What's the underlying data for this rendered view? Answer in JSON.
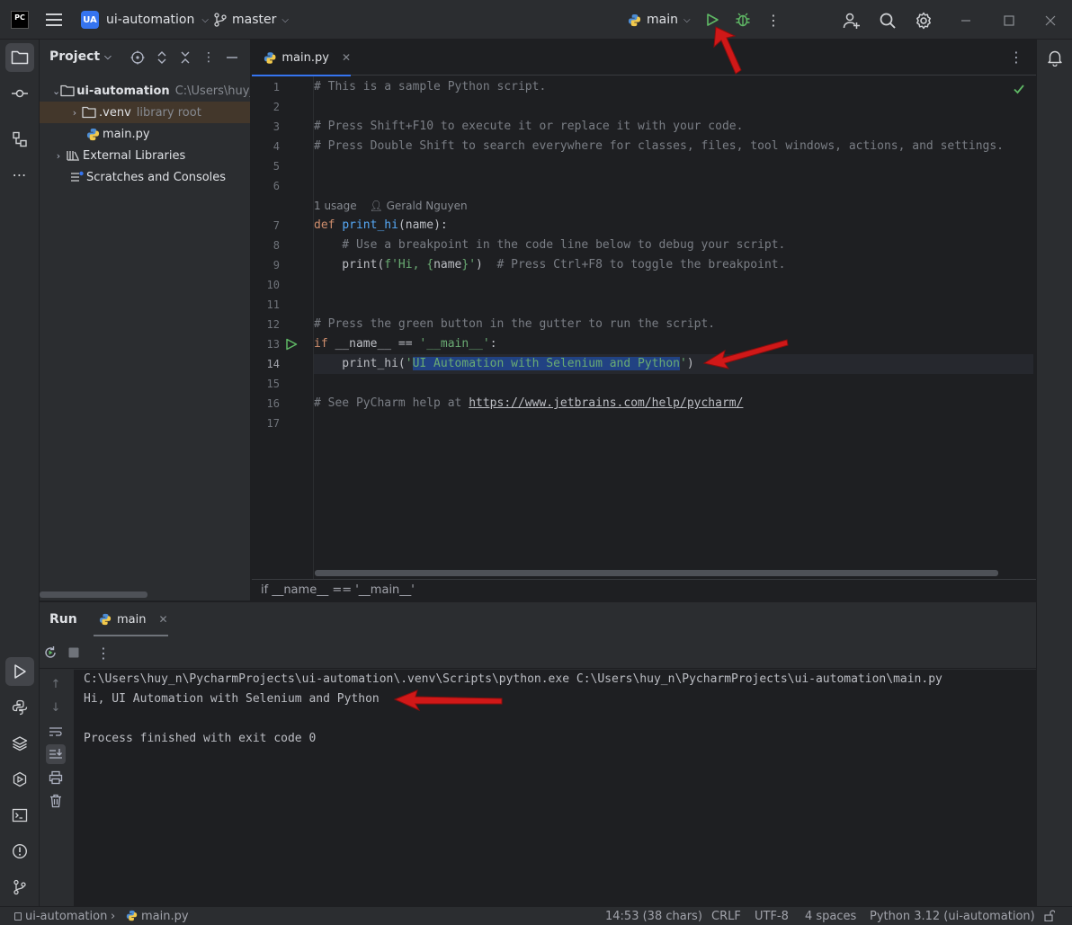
{
  "titlebar": {
    "logo": "PC",
    "project_badge": "UA",
    "project_name": "ui-automation",
    "branch": "master",
    "run_config": "main"
  },
  "project_pane": {
    "title": "Project",
    "tree": [
      {
        "label": "ui-automation",
        "hint": "C:\\Users\\huy_n"
      },
      {
        "label": ".venv",
        "hint": "library root"
      },
      {
        "label": "main.py",
        "hint": ""
      },
      {
        "label": "External Libraries",
        "hint": ""
      },
      {
        "label": "Scratches and Consoles",
        "hint": ""
      }
    ]
  },
  "editor": {
    "tab": "main.py",
    "line_numbers": [
      "1",
      "2",
      "3",
      "4",
      "5",
      "6",
      "7",
      "8",
      "9",
      "10",
      "11",
      "12",
      "13",
      "14",
      "15",
      "16",
      "17"
    ],
    "code": {
      "l1": "# This is a sample Python script.",
      "l3": "# Press Shift+F10 to execute it or replace it with your code.",
      "l4": "# Press Double Shift to search everywhere for classes, files, tool windows, actions, and settings.",
      "inlay_usage": "1 usage",
      "inlay_author": "Gerald Nguyen",
      "l7_kw": "def",
      "l7_fn": "print_hi",
      "l7_rest": "(name):",
      "l8": "    # Use a breakpoint in the code line below to debug your script.",
      "l9_call": "    print(",
      "l9_str_a": "f'Hi, {",
      "l9_var": "name",
      "l9_str_b": "}'",
      "l9_close": ")",
      "l9_comment": "  # Press Ctrl+F8 to toggle the breakpoint.",
      "l12": "# Press the green button in the gutter to run the script.",
      "l13_kw": "if",
      "l13_dn": "__name__",
      "l13_op": " == ",
      "l13_str": "'__main__'",
      "l13_colon": ":",
      "l14_call": "    print_hi(",
      "l14_quote_open": "'",
      "l14_selected": "UI Automation with Selenium and Python",
      "l14_quote_close": "'",
      "l14_close": ")",
      "l16_comment": "# See PyCharm help at ",
      "l16_link": "https://www.jetbrains.com/help/pycharm/"
    },
    "breadcrumb": "if __name__ == '__main__'"
  },
  "run_window": {
    "title": "Run",
    "tab": "main",
    "output": [
      "C:\\Users\\huy_n\\PycharmProjects\\ui-automation\\.venv\\Scripts\\python.exe C:\\Users\\huy_n\\PycharmProjects\\ui-automation\\main.py",
      "Hi, UI Automation with Selenium and Python",
      "",
      "Process finished with exit code 0"
    ]
  },
  "statusbar": {
    "crumb_project": "ui-automation",
    "crumb_file": "main.py",
    "position": "14:53 (38 chars)",
    "line_sep": "CRLF",
    "encoding": "UTF-8",
    "indent": "4 spaces",
    "interpreter": "Python 3.12 (ui-automation)"
  },
  "icons": {
    "run": "run-icon",
    "debug": "debug-bug-icon",
    "search": "search-icon",
    "settings": "gear-icon",
    "notifications": "bell-icon",
    "python_file": "python-file-icon"
  },
  "colors": {
    "accent": "#3574f0",
    "run_green": "#5fb865",
    "annotation_red": "#d01818"
  }
}
